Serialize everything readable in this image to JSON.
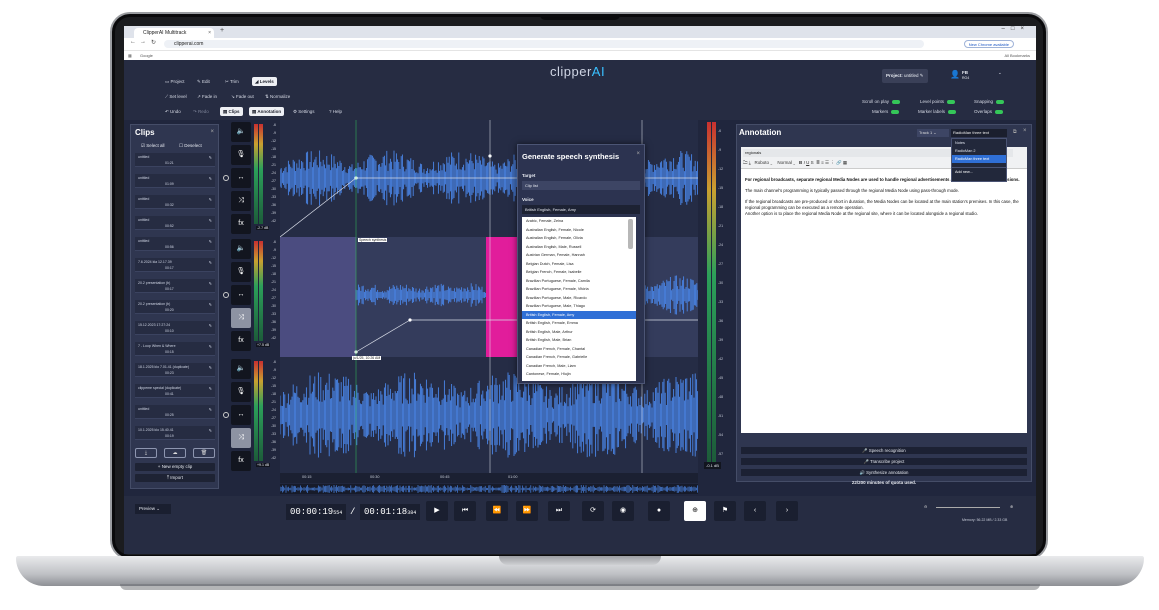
{
  "browser": {
    "tab_title": "ClipperAI Multitrack",
    "url": "clipperai.com",
    "bookmarks_left": "Google",
    "bookmarks_right": "All Bookmarks",
    "update_button": "New Chrome available"
  },
  "header": {
    "menu": [
      "Project",
      "Edit",
      "Trim",
      "Levels"
    ],
    "tools": [
      "Set level",
      "Fade in",
      "Fade out",
      "Normalize"
    ],
    "actions": [
      "Undo",
      "Redo",
      "Clips",
      "Annotation",
      "Settings",
      "Help"
    ],
    "logo_a": "clipper",
    "logo_b": "AI",
    "project_label": "Project:",
    "project_name": "untitled",
    "user_initials": "FB",
    "user_sub": "RO4",
    "toggles": [
      "Scroll on play",
      "Markers",
      "Level points",
      "Marker labels",
      "Snapping",
      "Overlaps"
    ]
  },
  "clips": {
    "title": "Clips",
    "select_all": "Select all",
    "deselect": "Deselect",
    "items": [
      {
        "name": "untitled",
        "dur": "01:21"
      },
      {
        "name": "untitled",
        "dur": "01:09"
      },
      {
        "name": "untitled",
        "dur": "00:32"
      },
      {
        "name": "untitled",
        "dur": "00:52"
      },
      {
        "name": "untitled",
        "dur": "00:56"
      },
      {
        "name": "7.6.2024 kla 12.17.39",
        "dur": "00:17"
      },
      {
        "name": "20.2 presentation (b)",
        "dur": "00:17"
      },
      {
        "name": "20.2 presentation (b)",
        "dur": "00:20"
      },
      {
        "name": "15.12.2023 17:27:24",
        "dur": "00:10"
      },
      {
        "name": "7 - Loop        When & Where",
        "dur": "00:15"
      },
      {
        "name": "18.1.2025 klo 7.01.41 (duplicate)",
        "dur": "00:23"
      },
      {
        "name": "clippeme special (duplicate)",
        "dur": "00:41"
      },
      {
        "name": "untitled",
        "dur": "00:25"
      },
      {
        "name": "10.1.2025 klo 15.40.41",
        "dur": "00:19"
      }
    ],
    "new_empty_clip": "New empty clip",
    "import": "Import"
  },
  "tracks": {
    "scale": [
      "-6",
      "-9",
      "-12",
      "-15",
      "-18",
      "-21",
      "-24",
      "-27",
      "-30",
      "-33",
      "-36",
      "-39",
      "-42",
      "-45",
      "-48",
      "-51",
      "-54",
      "-57"
    ],
    "gains": [
      "-2.7 dB",
      "+7.5 dB",
      "+9.1 dB"
    ],
    "speech_label": "Speech synthesis",
    "marker_time": "jo/1/25, 10:26 AM",
    "timeline": [
      "00:15",
      "00:30",
      "00:45",
      "01:00"
    ]
  },
  "dialog": {
    "title": "Generate speech synthesis",
    "target_label": "Target",
    "target_value": "Clip list",
    "voice_label": "Voice",
    "voice_value": "British English, Female, Amy",
    "voices": [
      "Arabic, Female, Zeina",
      "Australian English, Female, Nicole",
      "Australian English, Female, Olivia",
      "Australian English, Male, Russell",
      "Austrian German, Female, Hannah",
      "Belgian Dutch, Female, Lisa",
      "Belgian French, Female, Isabelle",
      "Brazilian Portuguese, Female, Camila",
      "Brazilian Portuguese, Female, Vitória",
      "Brazilian Portuguese, Male, Ricardo",
      "Brazilian Portuguese, Male, Thiago",
      "British English, Female, Amy",
      "British English, Female, Emma",
      "British English, Male, Arthur",
      "British English, Male, Brian",
      "Canadian French, Female, Chantal",
      "Canadian French, Female, Gabrielle",
      "Canadian French, Male, Liam",
      "Cantonese, Female, Hiujin",
      "Castilian Spanish, Female, Conchita"
    ],
    "selected_index": 11
  },
  "annotation": {
    "title": "Annotation",
    "track": "Track 1",
    "selected": "RadioMan three text",
    "options": [
      "Notes",
      "RadioMan 2",
      "RadioMan three text"
    ],
    "add_new": "Add new...",
    "doc_title": "regionals",
    "font": "Roboto",
    "size": "Normal",
    "p1": "For regional broadcasts, separate regional Media Nodes are used to handle regional advertisements and other regional transmissions.",
    "p2": "The main channel's programming is typically passed through the regional Media Node using pass-through mode.",
    "p3": "If the regional broadcasts are pre-produced or short in duration, the Media Nodes can be located at the main station's premises. In this case, the regional programming can be executed as a remote operation.",
    "p4": "Another option is to place the regional Media Node at the regional site, where it can be located alongside a regional studio.",
    "btn_speech": "Speech recognition",
    "btn_transcribe": "Transcribe project",
    "btn_synth": "Synthesize annotation",
    "quota": "22/200 minutes of quota used."
  },
  "transport": {
    "preview": "Preview",
    "time_cur": "00:00:19",
    "time_cur_ms": "554",
    "sep": "/",
    "time_total": "00:01:18",
    "time_total_ms": "384",
    "master_db": "-0.1 dB",
    "memory": "Memory: 56.22 MB / 2.33 GB"
  },
  "colors": {
    "waveform": "#4a86e8",
    "selection": "#6b6aa8",
    "magenta": "#e11d9b",
    "accent": "#39c0ff",
    "toggle_on": "#35c759"
  }
}
